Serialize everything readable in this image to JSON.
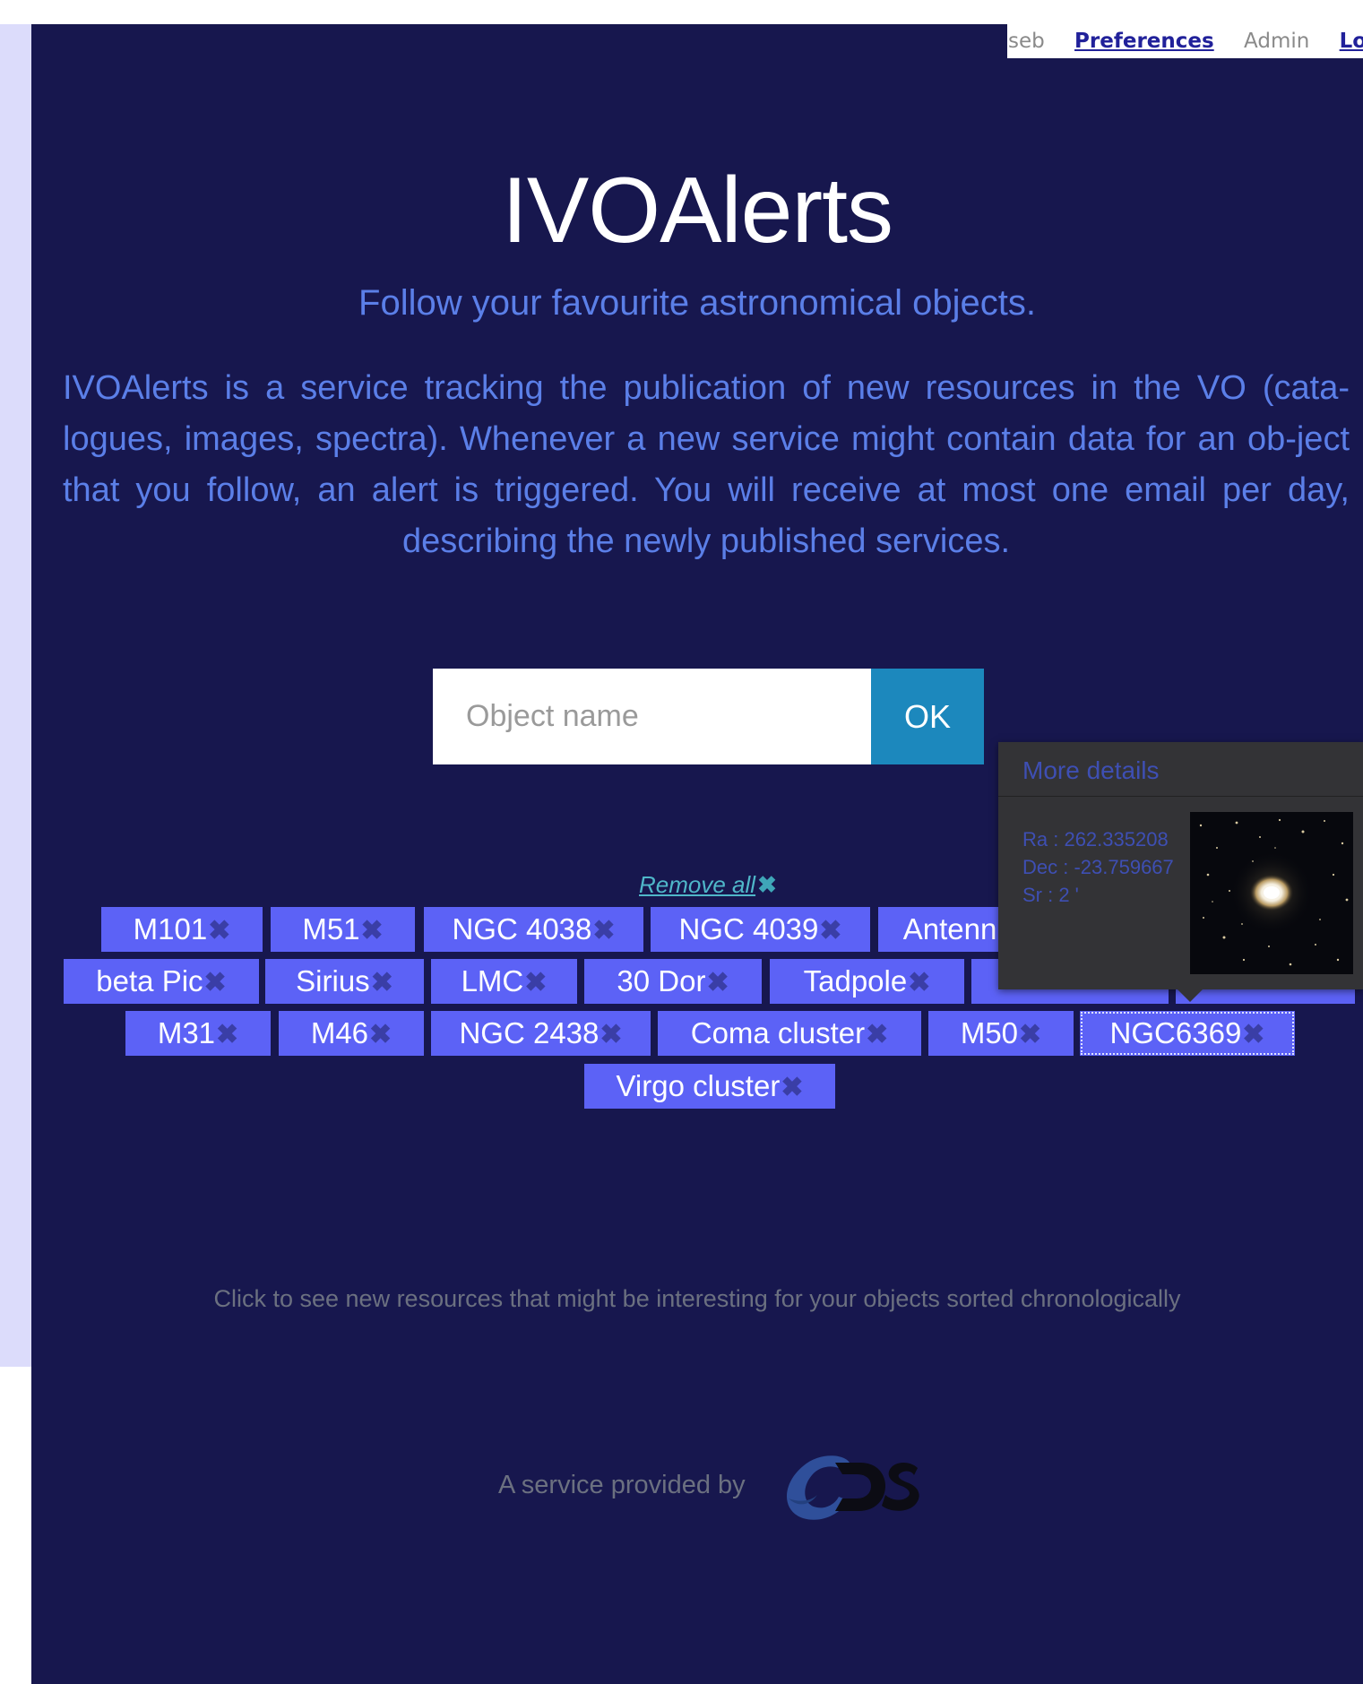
{
  "nav": {
    "user": "seb",
    "preferences": "Preferences",
    "admin": "Admin",
    "logout": "Logo"
  },
  "header": {
    "title": "IVOAlerts",
    "subtitle": "Follow your favourite astronomical objects.",
    "description": "IVOAlerts is a service tracking the publication of new resources in the VO (cata-logues, images, spectra). Whenever a new service might contain data for an ob-ject that you follow, an alert is triggered. You will receive at most one email per day, describing the newly published services."
  },
  "search": {
    "placeholder": "Object name",
    "value": "",
    "button": "OK"
  },
  "objects": {
    "remove_all": "Remove all",
    "remove_glyph": "✖",
    "tags": [
      {
        "label": "M101"
      },
      {
        "label": "M51"
      },
      {
        "label": "NGC 4038"
      },
      {
        "label": "NGC 4039"
      },
      {
        "label": "Antenn"
      },
      {
        "label": "beta Pic"
      },
      {
        "label": "Sirius"
      },
      {
        "label": "LMC"
      },
      {
        "label": "30 Dor"
      },
      {
        "label": "Tadpole"
      },
      {
        "label": ""
      },
      {
        "label": ""
      },
      {
        "label": "M31"
      },
      {
        "label": "M46"
      },
      {
        "label": "NGC 2438"
      },
      {
        "label": "Coma cluster"
      },
      {
        "label": "M50"
      },
      {
        "label": "NGC6369",
        "selected": true
      },
      {
        "label": "Virgo cluster"
      }
    ]
  },
  "popover": {
    "title": "More details",
    "ra": "Ra : 262.335208",
    "dec": "Dec : -23.759667",
    "sr": "Sr : 2 '"
  },
  "footer": {
    "resources_text": "Click to see new resources that might be interesting for your objects sorted chronologically",
    "provided_by": "A service provided by"
  },
  "colors": {
    "page_bg": "#17174e",
    "accent_text": "#5b7fe8",
    "tag_bg": "#5c62f6",
    "ok_button": "#1c88bd"
  }
}
